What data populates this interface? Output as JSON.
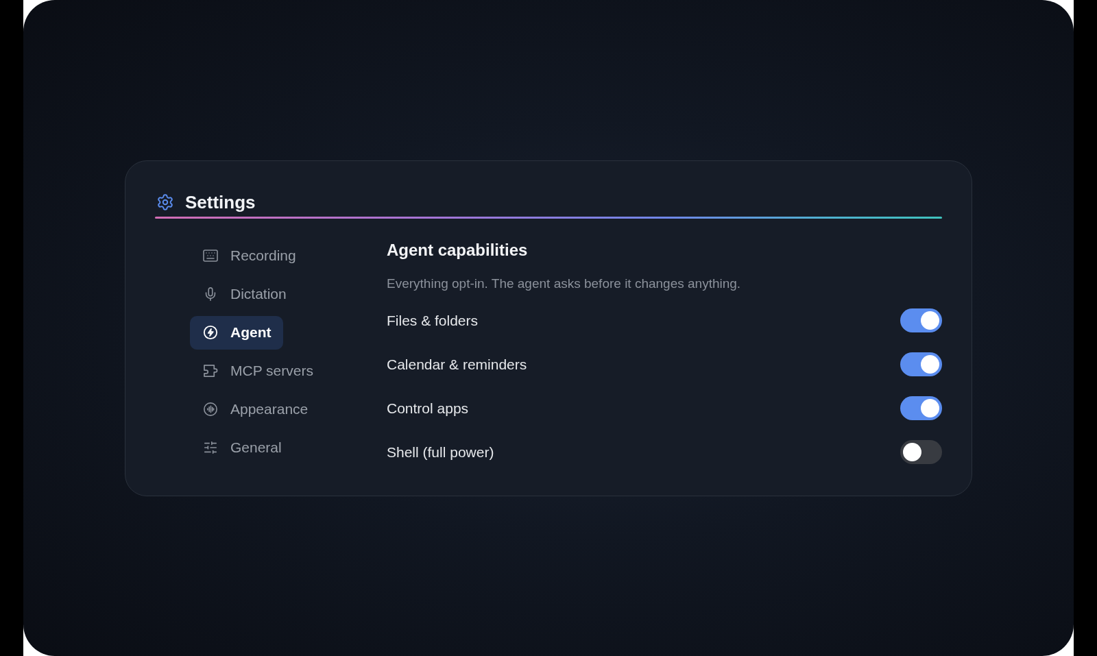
{
  "window": {
    "title": "Settings"
  },
  "nav": [
    {
      "label": "Recording",
      "selected": false
    },
    {
      "label": "Dictation",
      "selected": false
    },
    {
      "label": "Agent",
      "selected": true
    },
    {
      "label": "MCP servers",
      "selected": false
    },
    {
      "label": "Appearance",
      "selected": false
    },
    {
      "label": "General",
      "selected": false
    }
  ],
  "section": {
    "title": "Agent capabilities",
    "description": "Everything opt-in. The agent asks before it changes anything."
  },
  "options": [
    {
      "label": "Files & folders",
      "on": true
    },
    {
      "label": "Calendar & reminders",
      "on": true
    },
    {
      "label": "Control apps",
      "on": true
    },
    {
      "label": "Shell (full power)",
      "on": false
    }
  ]
}
